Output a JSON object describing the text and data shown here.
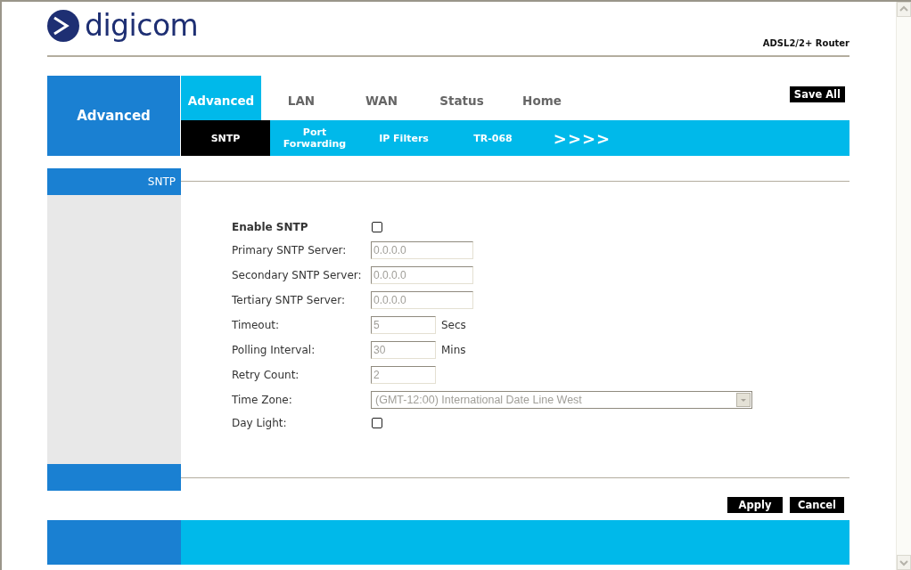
{
  "logo": {
    "text": "digicom"
  },
  "product": "ADSL2/2+ Router",
  "section_title": "Advanced",
  "tabs": [
    {
      "label": "Advanced",
      "selected": true
    },
    {
      "label": "LAN",
      "selected": false
    },
    {
      "label": "WAN",
      "selected": false
    },
    {
      "label": "Status",
      "selected": false
    },
    {
      "label": "Home",
      "selected": false
    }
  ],
  "save_all": "Save All",
  "subtabs": [
    {
      "label": "SNTP",
      "selected": true
    },
    {
      "label": "Port Forwarding",
      "selected": false
    },
    {
      "label": "IP Filters",
      "selected": false
    },
    {
      "label": "TR-068",
      "selected": false
    },
    {
      "label": ">>>>",
      "selected": false
    }
  ],
  "panel_title": "SNTP",
  "fields": [
    {
      "kind": "checkbox",
      "label": "Enable SNTP",
      "checked": false
    },
    {
      "kind": "text",
      "label": "Primary SNTP Server:",
      "value": "0.0.0.0",
      "disabled": true
    },
    {
      "kind": "text",
      "label": "Secondary SNTP Server:",
      "value": "0.0.0.0",
      "disabled": true
    },
    {
      "kind": "text",
      "label": "Tertiary SNTP Server:",
      "value": "0.0.0.0",
      "disabled": true
    },
    {
      "kind": "short",
      "label": "Timeout:",
      "value": "5",
      "unit": "Secs",
      "disabled": true
    },
    {
      "kind": "short",
      "label": "Polling Interval:",
      "value": "30",
      "unit": "Mins",
      "disabled": true
    },
    {
      "kind": "short",
      "label": "Retry Count:",
      "value": "2",
      "disabled": true
    },
    {
      "kind": "select",
      "label": "Time Zone:",
      "value": "(GMT-12:00) International Date Line West",
      "disabled": true
    },
    {
      "kind": "checkbox",
      "label": "Day Light:",
      "checked": false
    }
  ],
  "buttons": [
    "Apply",
    "Cancel"
  ]
}
